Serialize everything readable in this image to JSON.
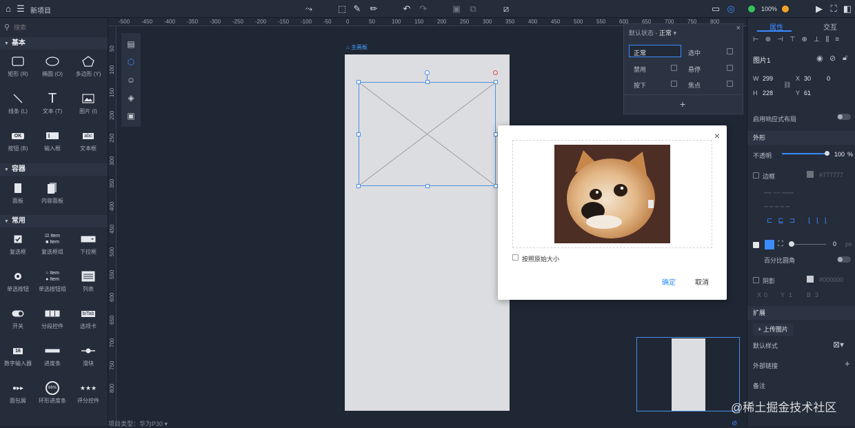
{
  "app": {
    "project_name": "新项目",
    "zoom": "100%"
  },
  "search": {
    "placeholder": "搜索"
  },
  "library": {
    "sections": [
      {
        "title": "基本",
        "items": [
          "矩形 (R)",
          "椭圆 (O)",
          "多边形 (Y)",
          "线条 (L)",
          "文本 (T)",
          "图片 (I)",
          "按钮 (B)",
          "输入框",
          "文本框"
        ]
      },
      {
        "title": "容器",
        "items": [
          "面板",
          "内容面板"
        ]
      },
      {
        "title": "常用",
        "items": [
          "复选框",
          "复选框组",
          "下拉框",
          "单选按钮",
          "单选按钮组",
          "列表",
          "开关",
          "分段控件",
          "选项卡",
          "数字输入器",
          "进度条",
          "滑块",
          "面包屑",
          "环形进度条",
          "评分控件"
        ]
      }
    ],
    "item_glyphs": {
      "button": "OK",
      "list": "abc",
      "tab": "biTab",
      "number": "16",
      "ring": "66%",
      "checkbox_item": "Item"
    }
  },
  "ruler": {
    "top": [
      "-500",
      "-450",
      "-400",
      "-350",
      "-300",
      "-250",
      "-200",
      "-150",
      "-100",
      "-50",
      "0",
      "50",
      "100",
      "150",
      "200",
      "250",
      "300",
      "350",
      "400",
      "450",
      "500",
      "550",
      "600",
      "650",
      "700",
      "750",
      "800"
    ],
    "left": [
      "50",
      "100",
      "150",
      "200",
      "250",
      "300",
      "350",
      "400",
      "450",
      "500",
      "550",
      "600",
      "650",
      "700",
      "750",
      "800"
    ]
  },
  "canvas": {
    "artboard_label": "主画板"
  },
  "state_panel": {
    "header_prefix": "默认状态 - ",
    "header_value": "正常",
    "states": [
      "正常",
      "选中",
      "禁用",
      "悬停",
      "按下",
      "焦点"
    ],
    "add": "+"
  },
  "modal": {
    "checkbox_label": "按照原始大小",
    "ok": "确定",
    "cancel": "取消",
    "close": "×"
  },
  "right_panel": {
    "tabs": [
      "属性",
      "交互"
    ],
    "name": "图片1",
    "w_label": "W",
    "w": "299",
    "x_label": "X",
    "x": "30",
    "rotation": "0",
    "h_label": "H",
    "h": "228",
    "y_label": "Y",
    "y": "61",
    "responsive": "启用响应式布局",
    "appearance": "外形",
    "opacity_label": "不透明",
    "opacity": "100",
    "percent": "%",
    "border": "边框",
    "border_color": "#777777",
    "radius": "0",
    "px": "px",
    "percent_radius": "百分比圆角",
    "shadow": "阴影",
    "shadow_color": "#000000",
    "shadow_x": "X",
    "shadow_y": "Y",
    "shadow_blur": "B",
    "shadow_vals": [
      "0",
      "1",
      "3"
    ],
    "extend": "扩展",
    "upload": "+ 上传图片",
    "default_style": "默认样式",
    "external_link": "外部链接",
    "notes": "备注"
  },
  "bottom": {
    "text": "项目类型：华为P30 ▾"
  },
  "watermark": "@稀土掘金技术社区"
}
